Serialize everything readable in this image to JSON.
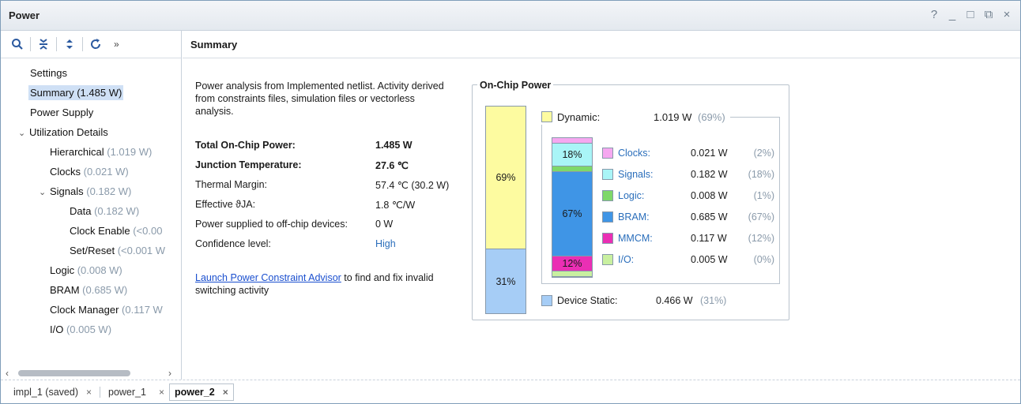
{
  "window": {
    "title": "Power",
    "controls": [
      "?",
      "_",
      "□",
      "⧉",
      "×"
    ]
  },
  "toolbar": {
    "icons": [
      "search-icon",
      "collapse-all-icon",
      "expand-all-icon",
      "refresh-icon"
    ],
    "more": "»"
  },
  "tree": {
    "items": [
      {
        "label": "Settings",
        "sub": ""
      },
      {
        "label": "Summary (1.485 W)",
        "sub": ""
      },
      {
        "label": "Power Supply",
        "sub": ""
      },
      {
        "label": "Utilization Details",
        "sub": "",
        "chevron": "⌄"
      },
      {
        "label": "Hierarchical",
        "sub": " (1.019 W)"
      },
      {
        "label": "Clocks",
        "sub": " (0.021 W)"
      },
      {
        "label": "Signals",
        "sub": " (0.182 W)",
        "chevron": "⌄"
      },
      {
        "label": "Data",
        "sub": " (0.182 W)"
      },
      {
        "label": "Clock Enable",
        "sub": " (<0.00"
      },
      {
        "label": "Set/Reset",
        "sub": " (<0.001 W"
      },
      {
        "label": "Logic",
        "sub": " (0.008 W)"
      },
      {
        "label": "BRAM",
        "sub": " (0.685 W)"
      },
      {
        "label": "Clock Manager",
        "sub": " (0.117 W"
      },
      {
        "label": "I/O",
        "sub": " (0.005 W)"
      }
    ]
  },
  "summary": {
    "header": "Summary",
    "description": "Power analysis from Implemented netlist. Activity derived from constraints files, simulation files or vectorless analysis.",
    "stats": [
      {
        "key": "Total On-Chip Power:",
        "value": "1.485 W"
      },
      {
        "key": "Junction Temperature:",
        "value": "27.6 ℃"
      },
      {
        "key": "Thermal Margin:",
        "value": "57.4 ℃ (30.2 W)"
      },
      {
        "key": "Effective ϑJA:",
        "value": "1.8 ℃/W"
      },
      {
        "key": "Power supplied to off-chip devices:",
        "value": "0 W"
      },
      {
        "key": "Confidence level:",
        "value": "High"
      }
    ],
    "advisor_link": "Launch Power Constraint Advisor",
    "advisor_text": " to find and fix invalid switching activity"
  },
  "onchip": {
    "title": "On-Chip Power",
    "dynamic": {
      "label": "Dynamic:",
      "value": "1.019 W",
      "pct": "(69%)",
      "bar_pct": "69%",
      "fraction": 0.69
    },
    "static": {
      "label": "Device Static:",
      "value": "0.466 W",
      "pct": "(31%)",
      "bar_pct": "31%",
      "fraction": 0.31
    },
    "breakdown": [
      {
        "name": "Clocks:",
        "value": "0.021 W",
        "pct": "(2%)",
        "bar_label": "",
        "color": "#f5a8f0"
      },
      {
        "name": "Signals:",
        "value": "0.182 W",
        "pct": "(18%)",
        "bar_label": "18%",
        "color": "#a9f5f7"
      },
      {
        "name": "Logic:",
        "value": "0.008 W",
        "pct": "(1%)",
        "bar_label": "",
        "color": "#7ed86a"
      },
      {
        "name": "BRAM:",
        "value": "0.685 W",
        "pct": "(67%)",
        "bar_label": "67%",
        "color": "#3f95e6"
      },
      {
        "name": "MMCM:",
        "value": "0.117 W",
        "pct": "(12%)",
        "bar_label": "12%",
        "color": "#ea2fb4"
      },
      {
        "name": "I/O:",
        "value": "0.005 W",
        "pct": "(0%)",
        "bar_label": "",
        "color": "#c9f0a0"
      }
    ],
    "colors": {
      "dynamic": "#fdfba0",
      "static": "#a6cdf6"
    }
  },
  "tabs": [
    {
      "label": "impl_1 (saved)",
      "close": "×",
      "active": false
    },
    {
      "label": "power_1",
      "close": "×",
      "active": false
    },
    {
      "label": "power_2",
      "close": "×",
      "active": true
    }
  ]
}
